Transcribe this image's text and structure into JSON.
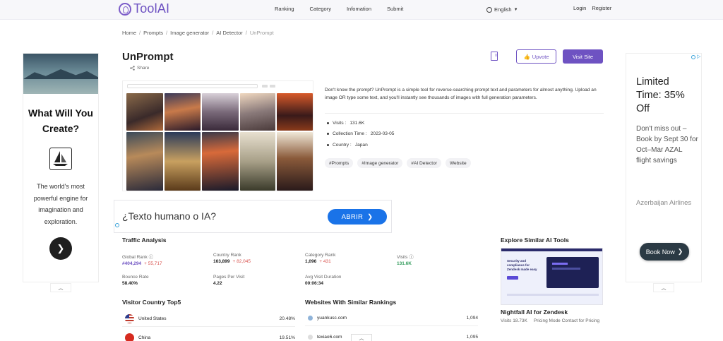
{
  "header": {
    "logo_text": "ToolAI",
    "nav": [
      "Ranking",
      "Category",
      "Infomation",
      "Submit"
    ],
    "language": "English",
    "login": "Login",
    "register": "Register"
  },
  "breadcrumb": [
    "Home",
    "Prompts",
    "Image generator",
    "AI Detector",
    "UnPrompt"
  ],
  "tool": {
    "name": "UnPrompt",
    "share": "Share",
    "upvote": "Upvote",
    "visit": "Visit Site",
    "description": "Don't know the prompt? UnPrompt is a simple tool for reverse-searching prompt text and parameters for almost anything. Upload an image OR type some text, and you'll instantly see thousands of images with full generation parameters.",
    "visits_label": "Visits :",
    "visits_value": "131.6K",
    "collection_label": "Collection Time :",
    "collection_value": "2023-03-05",
    "country_label": "Country :",
    "country_value": "Japan",
    "tags": [
      "#Prompts",
      "#Image generator",
      "#AI Detector",
      "Website"
    ]
  },
  "inline_ad": {
    "question": "¿Texto humano o IA?",
    "button": "ABRIR"
  },
  "traffic": {
    "title": "Traffic Analysis",
    "global_rank_label": "Global Rank",
    "global_rank_value": "#404,294",
    "global_rank_change": "+ 55,717",
    "country_rank_label": "Country Rank",
    "country_rank_value": "163,899",
    "country_rank_change": "+ 82,045",
    "category_rank_label": "Category Rank",
    "category_rank_value": "1,096",
    "category_rank_change": "+ 431",
    "visits_label": "Visits",
    "visits_value": "131.6K",
    "bounce_label": "Bounce Rate",
    "bounce_value": "58.40%",
    "pages_label": "Pages Per Visit",
    "pages_value": "4.22",
    "duration_label": "Avg Visit Duration",
    "duration_value": "00:06:34"
  },
  "countries": {
    "title": "Visitor Country Top5",
    "rows": [
      {
        "name": "United States",
        "pct": "20.48%"
      },
      {
        "name": "China",
        "pct": "19.51%"
      }
    ]
  },
  "similar_rank": {
    "title": "Websites With Similar Rankings",
    "rows": [
      {
        "site": "yuankusc.com",
        "rank": "1,094"
      },
      {
        "site": "texiao6.com",
        "rank": "1,095"
      }
    ]
  },
  "similar_tools": {
    "title": "Explore Similar AI Tools",
    "card_headline": "Security and compliance for Zendesk made easy",
    "name": "Nightfall AI for Zendesk",
    "visits": "Visits 18.73K",
    "pricing": "Pricing Mode Contact for Pricing"
  },
  "left_ad": {
    "headline": "What Will You Create?",
    "body": "The world's most powerful engine for imagination and exploration."
  },
  "right_ad": {
    "headline": "Limited Time: 35% Off",
    "body": "Don't miss out – Book by Sept 30 for Oct–Mar AZAL flight savings",
    "brand": "Azerbaijan Airlines",
    "button": "Book Now"
  },
  "colors": {
    "brand": "#6e52c2",
    "rank_change": "#d9534f",
    "visits_green": "#2f9a59",
    "ad_blue": "#1a73e8"
  }
}
